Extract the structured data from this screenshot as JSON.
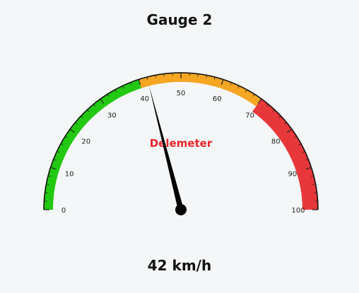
{
  "chart_data": {
    "type": "gauge",
    "title": "Gauge 2",
    "caption": "Delemeter",
    "caption_color": "#e8262b",
    "value": 42,
    "value_display": "42 km/h",
    "range": [
      0,
      100
    ],
    "major_ticks": [
      "0",
      "10",
      "20",
      "30",
      "40",
      "50",
      "60",
      "70",
      "80",
      "90",
      "100"
    ],
    "bands": [
      {
        "from": 0,
        "to": 40,
        "color": "#22c812"
      },
      {
        "from": 40,
        "to": 70,
        "color": "#f5a623"
      },
      {
        "from": 70,
        "to": 100,
        "color": "#e8373a"
      }
    ],
    "needle_color": "#000000"
  }
}
